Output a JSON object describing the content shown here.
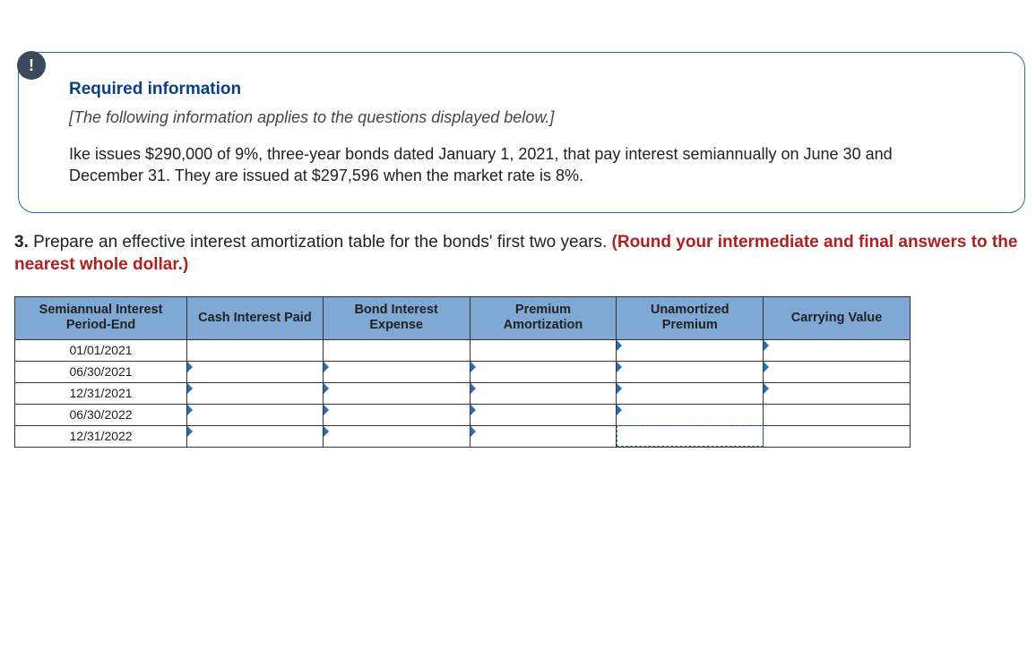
{
  "info": {
    "badge": "!",
    "title": "Required information",
    "intro": "[The following information applies to the questions displayed below.]",
    "text": "Ike issues $290,000 of 9%, three-year bonds dated January 1, 2021, that pay interest semiannually on June 30 and December 31. They are issued at $297,596 when the market rate is 8%."
  },
  "question": {
    "number": "3.",
    "black": " Prepare an effective interest amortization table for the bonds' first two years. ",
    "red": "(Round your intermediate and final answers to the nearest whole dollar.)"
  },
  "table": {
    "headers": {
      "period": "Semiannual Interest Period-End",
      "cash": "Cash Interest Paid",
      "expense": "Bond Interest Expense",
      "amort": "Premium Amortization",
      "unamort": "Unamortized Premium",
      "carry": "Carrying Value"
    },
    "rows": [
      {
        "date": "01/01/2021",
        "cash": "",
        "expense": "",
        "amort": "",
        "unamort": "",
        "carry": ""
      },
      {
        "date": "06/30/2021",
        "cash": "",
        "expense": "",
        "amort": "",
        "unamort": "",
        "carry": ""
      },
      {
        "date": "12/31/2021",
        "cash": "",
        "expense": "",
        "amort": "",
        "unamort": "",
        "carry": ""
      },
      {
        "date": "06/30/2022",
        "cash": "",
        "expense": "",
        "amort": "",
        "unamort": "",
        "carry": ""
      },
      {
        "date": "12/31/2022",
        "cash": "",
        "expense": "",
        "amort": "",
        "unamort": "",
        "carry": ""
      }
    ]
  }
}
